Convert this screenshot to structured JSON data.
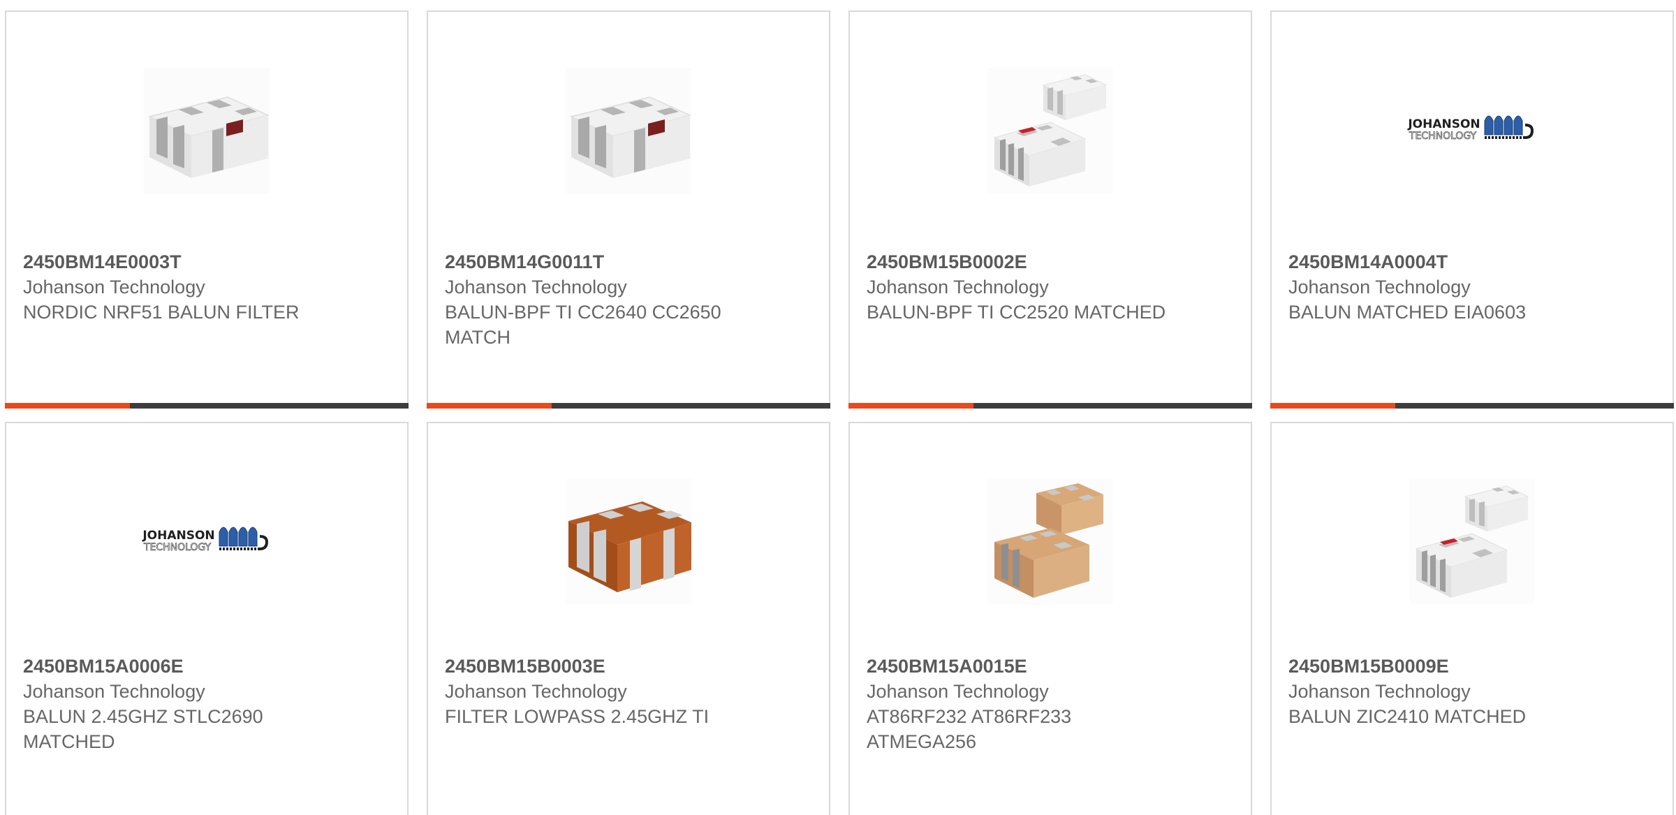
{
  "colors": {
    "accent": "#e8491d",
    "bar_dark": "#3d3d3d",
    "border": "#d9d9d9",
    "text": "#666666"
  },
  "bar_accent_fraction": 0.31,
  "products": [
    {
      "part_number": "2450BM14E0003T",
      "manufacturer": "Johanson Technology",
      "description": "NORDIC NRF51 BALUN FILTER",
      "image": "white-chip-icon"
    },
    {
      "part_number": "2450BM14G0011T",
      "manufacturer": "Johanson Technology",
      "description": "BALUN-BPF TI CC2640 CC2650 MATCH",
      "image": "white-chip-icon"
    },
    {
      "part_number": "2450BM15B0002E",
      "manufacturer": "Johanson Technology",
      "description": "BALUN-BPF TI CC2520 MATCHED",
      "image": "white-chip-pair-icon"
    },
    {
      "part_number": "2450BM14A0004T",
      "manufacturer": "Johanson Technology",
      "description": "BALUN MATCHED EIA0603",
      "image": "johanson-logo"
    },
    {
      "part_number": "2450BM15A0006E",
      "manufacturer": "Johanson Technology",
      "description": "BALUN 2.45GHZ STLC2690 MATCHED",
      "image": "johanson-logo"
    },
    {
      "part_number": "2450BM15B0003E",
      "manufacturer": "Johanson Technology",
      "description": "FILTER LOWPASS 2.45GHZ TI",
      "image": "brown-chip-icon"
    },
    {
      "part_number": "2450BM15A0015E",
      "manufacturer": "Johanson Technology",
      "description": "AT86RF232 AT86RF233 ATMEGA256",
      "image": "tan-chip-pair-icon"
    },
    {
      "part_number": "2450BM15B0009E",
      "manufacturer": "Johanson Technology",
      "description": "BALUN ZIC2410 MATCHED",
      "image": "white-chip-pair-icon"
    }
  ],
  "logo": {
    "line1": "JOHANSON",
    "line2": "TECHNOLOGY"
  }
}
